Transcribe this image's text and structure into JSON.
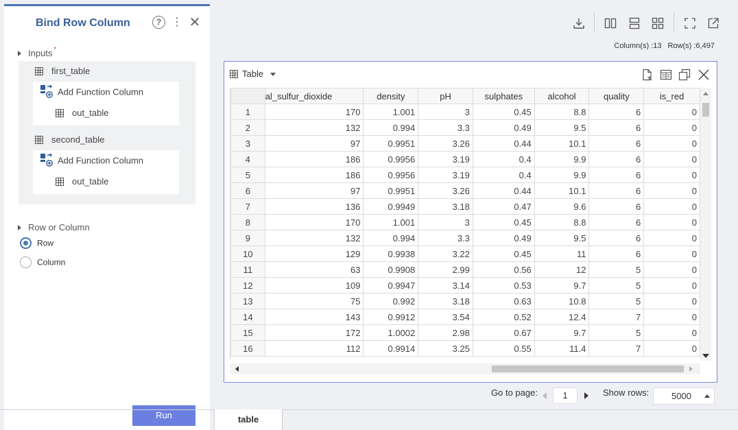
{
  "left_panel": {
    "title": "Bind Row Column",
    "inputs_label": "Inputs",
    "required_mark": "*",
    "first_table": {
      "name": "first_table",
      "function_label": "Add Function Column",
      "out_label": "out_table"
    },
    "second_table": {
      "name": "second_table",
      "function_label": "Add Function Column",
      "out_label": "out_table"
    },
    "row_or_column_label": "Row or Column",
    "options": [
      {
        "label": "Row",
        "selected": true
      },
      {
        "label": "Column",
        "selected": false
      }
    ],
    "run_label": "Run"
  },
  "toolbar": {
    "icons": [
      "download-icon",
      "two-column-layout-icon",
      "two-row-layout-icon",
      "four-grid-layout-icon",
      "fullscreen-icon",
      "open-external-icon"
    ]
  },
  "counts": {
    "columns": "Column(s) :13",
    "rows": "Row(s) :6,497"
  },
  "table_panel": {
    "title": "Table",
    "columns": [
      "al_sulfur_dioxide",
      "density",
      "pH",
      "sulphates",
      "alcohol",
      "quality",
      "is_red"
    ],
    "rows": [
      [
        "1",
        "170",
        "1.001",
        "3",
        "0.45",
        "8.8",
        "6",
        "0"
      ],
      [
        "2",
        "132",
        "0.994",
        "3.3",
        "0.49",
        "9.5",
        "6",
        "0"
      ],
      [
        "3",
        "97",
        "0.9951",
        "3.26",
        "0.44",
        "10.1",
        "6",
        "0"
      ],
      [
        "4",
        "186",
        "0.9956",
        "3.19",
        "0.4",
        "9.9",
        "6",
        "0"
      ],
      [
        "5",
        "186",
        "0.9956",
        "3.19",
        "0.4",
        "9.9",
        "6",
        "0"
      ],
      [
        "6",
        "97",
        "0.9951",
        "3.26",
        "0.44",
        "10.1",
        "6",
        "0"
      ],
      [
        "7",
        "136",
        "0.9949",
        "3.18",
        "0.47",
        "9.6",
        "6",
        "0"
      ],
      [
        "8",
        "170",
        "1.001",
        "3",
        "0.45",
        "8.8",
        "6",
        "0"
      ],
      [
        "9",
        "132",
        "0.994",
        "3.3",
        "0.49",
        "9.5",
        "6",
        "0"
      ],
      [
        "10",
        "129",
        "0.9938",
        "3.22",
        "0.45",
        "11",
        "6",
        "0"
      ],
      [
        "11",
        "63",
        "0.9908",
        "2.99",
        "0.56",
        "12",
        "5",
        "0"
      ],
      [
        "12",
        "109",
        "0.9947",
        "3.14",
        "0.53",
        "9.7",
        "5",
        "0"
      ],
      [
        "13",
        "75",
        "0.992",
        "3.18",
        "0.63",
        "10.8",
        "5",
        "0"
      ],
      [
        "14",
        "143",
        "0.9912",
        "3.54",
        "0.52",
        "12.4",
        "7",
        "0"
      ],
      [
        "15",
        "172",
        "1.0002",
        "2.98",
        "0.67",
        "9.7",
        "5",
        "0"
      ],
      [
        "16",
        "112",
        "0.9914",
        "3.25",
        "0.55",
        "11.4",
        "7",
        "0"
      ]
    ]
  },
  "pager": {
    "goto_label": "Go to page:",
    "page": "1",
    "show_rows_label": "Show rows:",
    "show_rows_value": "5000"
  },
  "bottom_tab": {
    "label": "table"
  },
  "colors": {
    "accent": "#4a74b4",
    "run_button": "#6b7fe0",
    "panel_border": "#7f86e4"
  }
}
